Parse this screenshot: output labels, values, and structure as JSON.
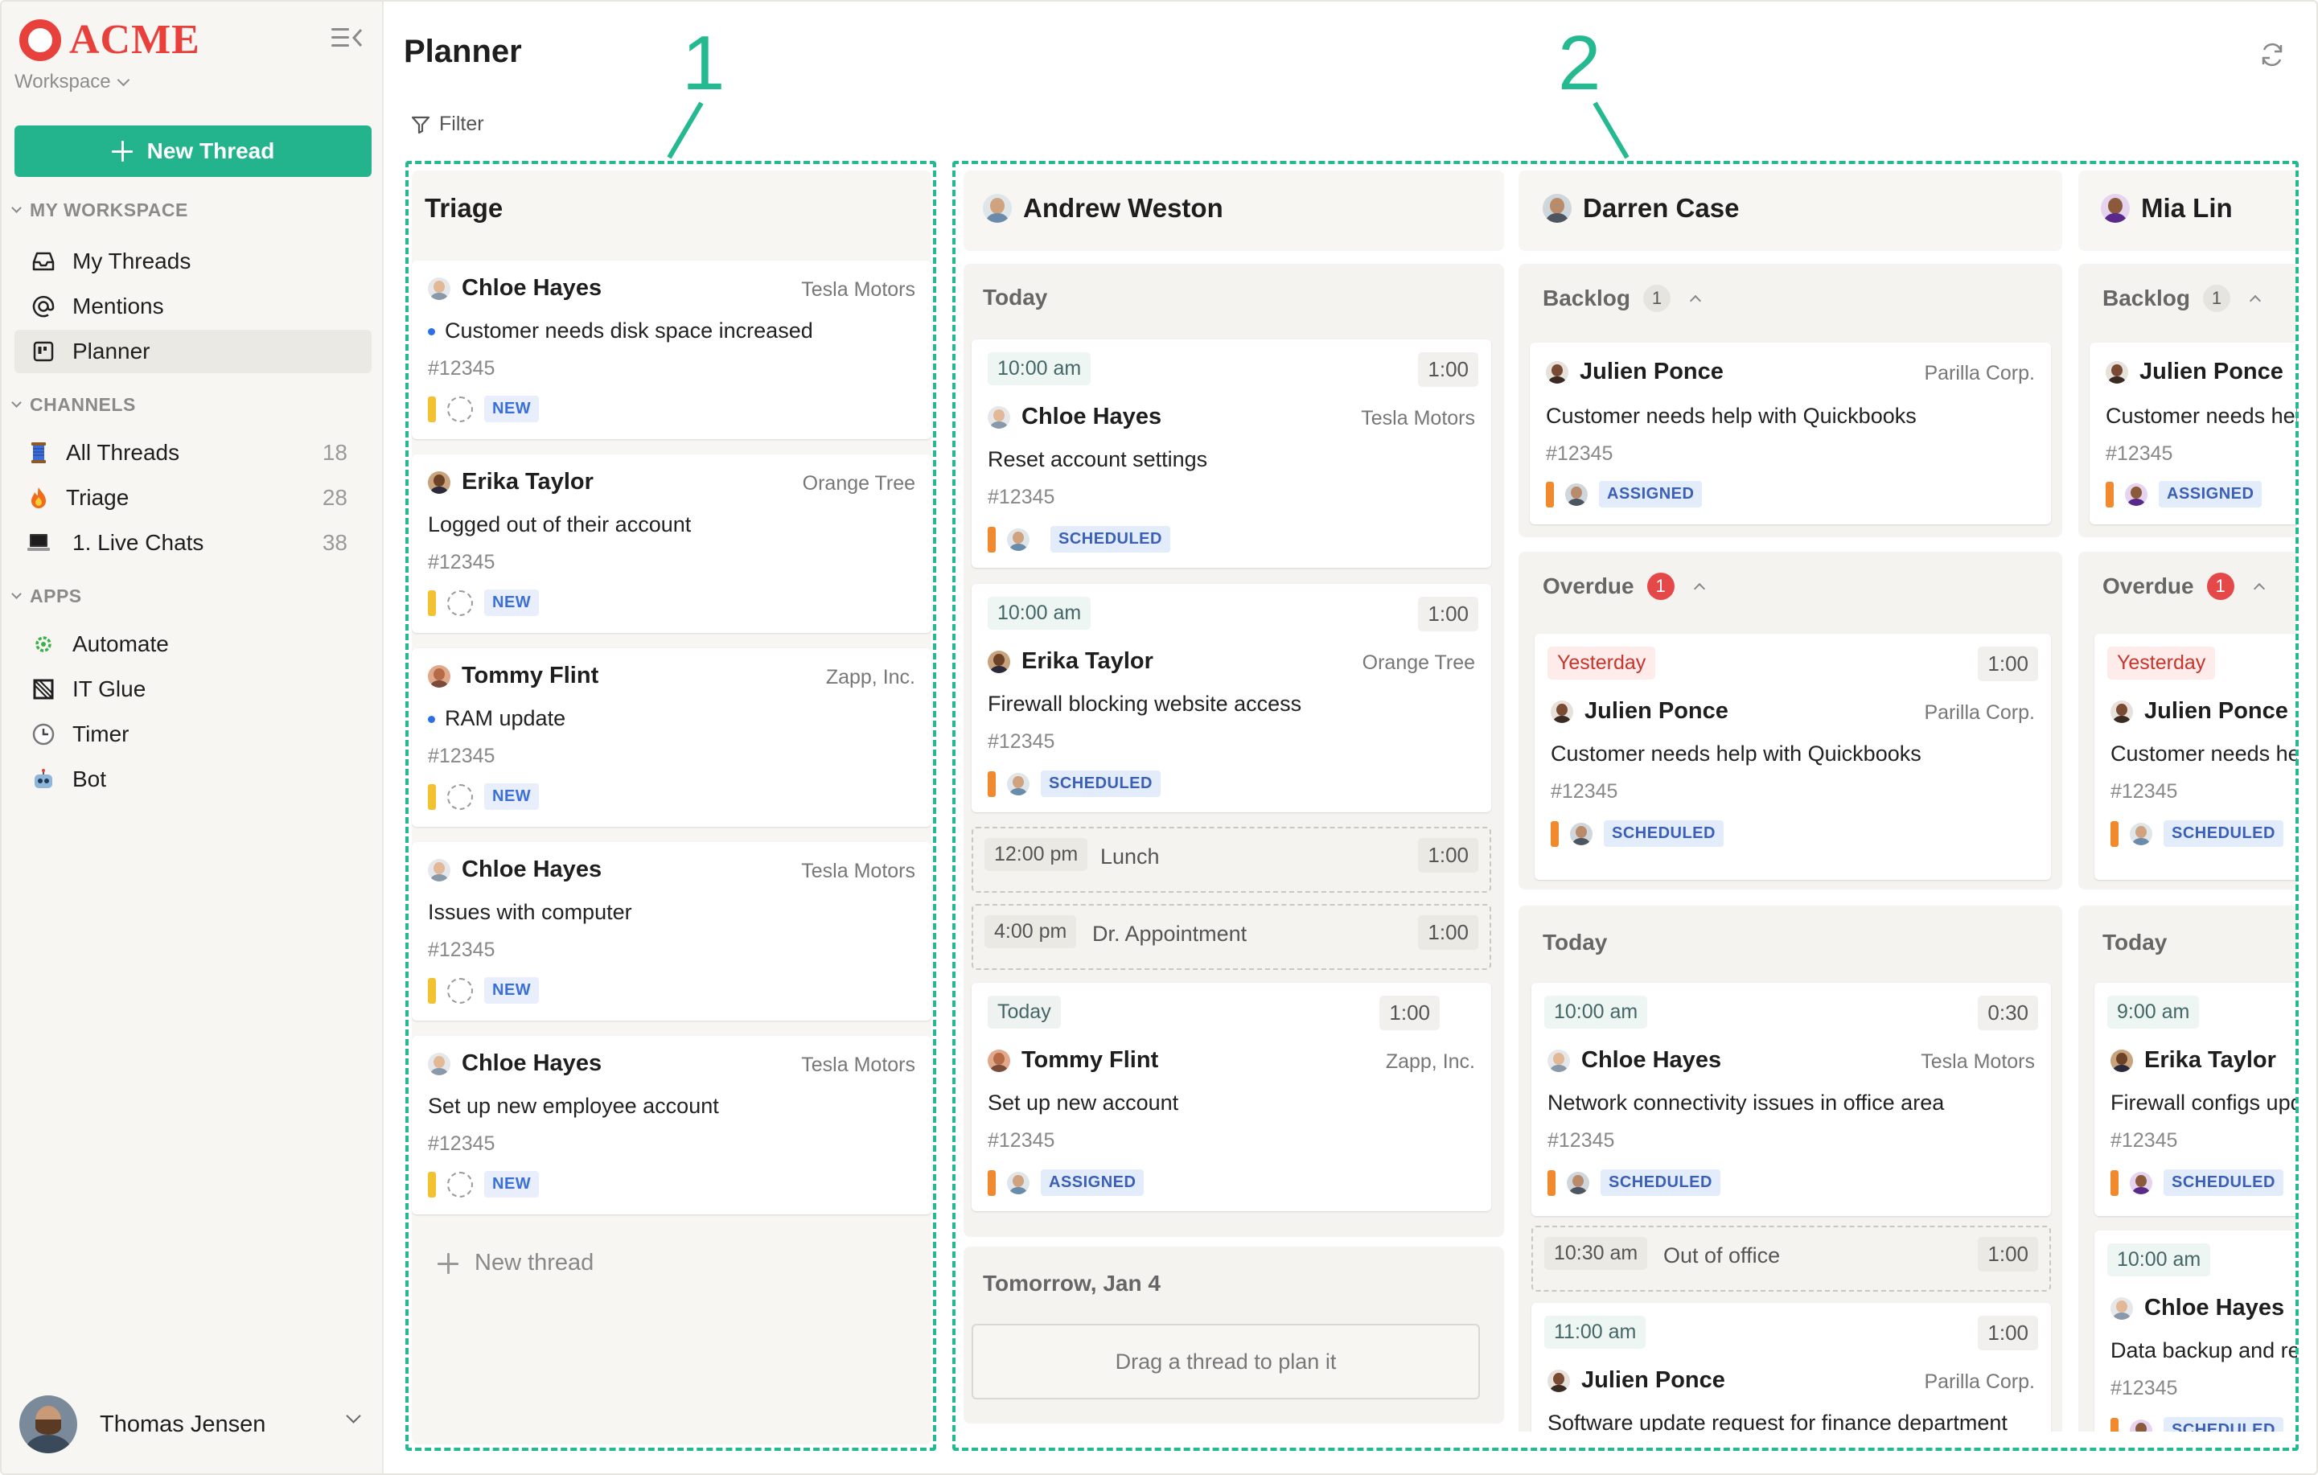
{
  "brand": {
    "name": "ACME",
    "color": "#e8413c"
  },
  "accent": "#23b48d",
  "sidebar": {
    "workspace": "Workspace",
    "new_thread": "New Thread",
    "section_workspace": "MY WORKSPACE",
    "workspace_items": [
      {
        "label": "My Threads",
        "icon": "inbox-icon"
      },
      {
        "label": "Mentions",
        "icon": "at-icon"
      },
      {
        "label": "Planner",
        "icon": "planner-icon",
        "active": true
      }
    ],
    "section_channels": "CHANNELS",
    "channels": [
      {
        "label": "All Threads",
        "count": "18",
        "icon": "spool-icon"
      },
      {
        "label": "Triage",
        "count": "28",
        "icon": "fire-icon"
      },
      {
        "label": "1. Live Chats",
        "count": "38",
        "icon": "laptop-icon"
      }
    ],
    "section_apps": "APPS",
    "apps": [
      {
        "label": "Automate",
        "icon": "gear-icon"
      },
      {
        "label": "IT Glue",
        "icon": "itglue-icon"
      },
      {
        "label": "Timer",
        "icon": "clock-icon"
      },
      {
        "label": "Bot",
        "icon": "robot-icon"
      }
    ],
    "user": "Thomas Jensen"
  },
  "page": {
    "title": "Planner",
    "filter": "Filter"
  },
  "callouts": {
    "one": "1",
    "two": "2"
  },
  "triage": {
    "title": "Triage",
    "cards": [
      {
        "name": "Chloe Hayes",
        "org": "Tesla Motors",
        "desc": "Customer needs disk space increased",
        "dot": true,
        "num": "#12345",
        "tag": "NEW"
      },
      {
        "name": "Erika Taylor",
        "org": "Orange Tree",
        "desc": "Logged out of their account",
        "dot": false,
        "num": "#12345",
        "tag": "NEW"
      },
      {
        "name": "Tommy Flint",
        "org": "Zapp, Inc.",
        "desc": "RAM update",
        "dot": true,
        "num": "#12345",
        "tag": "NEW"
      },
      {
        "name": "Chloe Hayes",
        "org": "Tesla Motors",
        "desc": "Issues with computer",
        "dot": false,
        "num": "#12345",
        "tag": "NEW"
      },
      {
        "name": "Chloe Hayes",
        "org": "Tesla Motors",
        "desc": "Set up new employee account",
        "dot": false,
        "num": "#12345",
        "tag": "NEW"
      }
    ],
    "new_thread": "New thread"
  },
  "andrew": {
    "name": "Andrew Weston",
    "today": "Today",
    "c1": {
      "time": "10:00 am",
      "dur": "1:00",
      "name": "Chloe Hayes",
      "org": "Tesla Motors",
      "desc": "Reset account settings",
      "num": "#12345",
      "tag": "SCHEDULED"
    },
    "c2": {
      "time": "10:00 am",
      "dur": "1:00",
      "name": "Erika Taylor",
      "org": "Orange Tree",
      "desc": "Firewall blocking website access",
      "num": "#12345",
      "tag": "SCHEDULED"
    },
    "e1": {
      "time": "12:00 pm",
      "name": "Lunch",
      "dur": "1:00"
    },
    "e2": {
      "time": "4:00 pm",
      "name": "Dr. Appointment",
      "dur": "1:00"
    },
    "c3": {
      "time": "Today",
      "dur": "1:00",
      "name": "Tommy Flint",
      "org": "Zapp, Inc.",
      "desc": "Set up new account",
      "num": "#12345",
      "tag": "ASSIGNED"
    },
    "tomorrow": "Tomorrow, Jan 4",
    "drag": "Drag a thread to plan it"
  },
  "darren": {
    "name": "Darren Case",
    "backlog": "Backlog",
    "backlog_count": "1",
    "b1": {
      "name": "Julien Ponce",
      "org": "Parilla Corp.",
      "desc": "Customer needs help with Quickbooks",
      "num": "#12345",
      "tag": "ASSIGNED"
    },
    "overdue": "Overdue",
    "overdue_count": "1",
    "o1": {
      "time": "Yesterday",
      "dur": "1:00",
      "name": "Julien Ponce",
      "org": "Parilla Corp.",
      "desc": "Customer needs help with Quickbooks",
      "num": "#12345",
      "tag": "SCHEDULED"
    },
    "today": "Today",
    "t1": {
      "time": "10:00 am",
      "dur": "0:30",
      "name": "Chloe Hayes",
      "org": "Tesla Motors",
      "desc": "Network connectivity issues in office area",
      "num": "#12345",
      "tag": "SCHEDULED"
    },
    "e1": {
      "time": "10:30 am",
      "name": "Out of office",
      "dur": "1:00"
    },
    "t2": {
      "time": "11:00 am",
      "dur": "1:00",
      "name": "Julien Ponce",
      "org": "Parilla Corp.",
      "desc": "Software update request for finance department"
    }
  },
  "mia": {
    "name": "Mia Lin",
    "backlog": "Backlog",
    "backlog_count": "1",
    "b1": {
      "name": "Julien Ponce",
      "desc": "Customer needs help with Quickbooks",
      "num": "#12345",
      "tag": "ASSIGNED"
    },
    "overdue": "Overdue",
    "overdue_count": "1",
    "o1": {
      "time": "Yesterday",
      "name": "Julien Ponce",
      "desc": "Customer needs help with Quickbooks",
      "num": "#12345",
      "tag": "SCHEDULED"
    },
    "today": "Today",
    "t1": {
      "time": "9:00 am",
      "name": "Erika Taylor",
      "desc": "Firewall configs update",
      "num": "#12345",
      "tag": "SCHEDULED"
    },
    "t2": {
      "time": "10:00 am",
      "name": "Chloe Hayes",
      "desc": "Data backup and recovery",
      "num": "#12345",
      "tag": "SCHEDULED"
    }
  }
}
